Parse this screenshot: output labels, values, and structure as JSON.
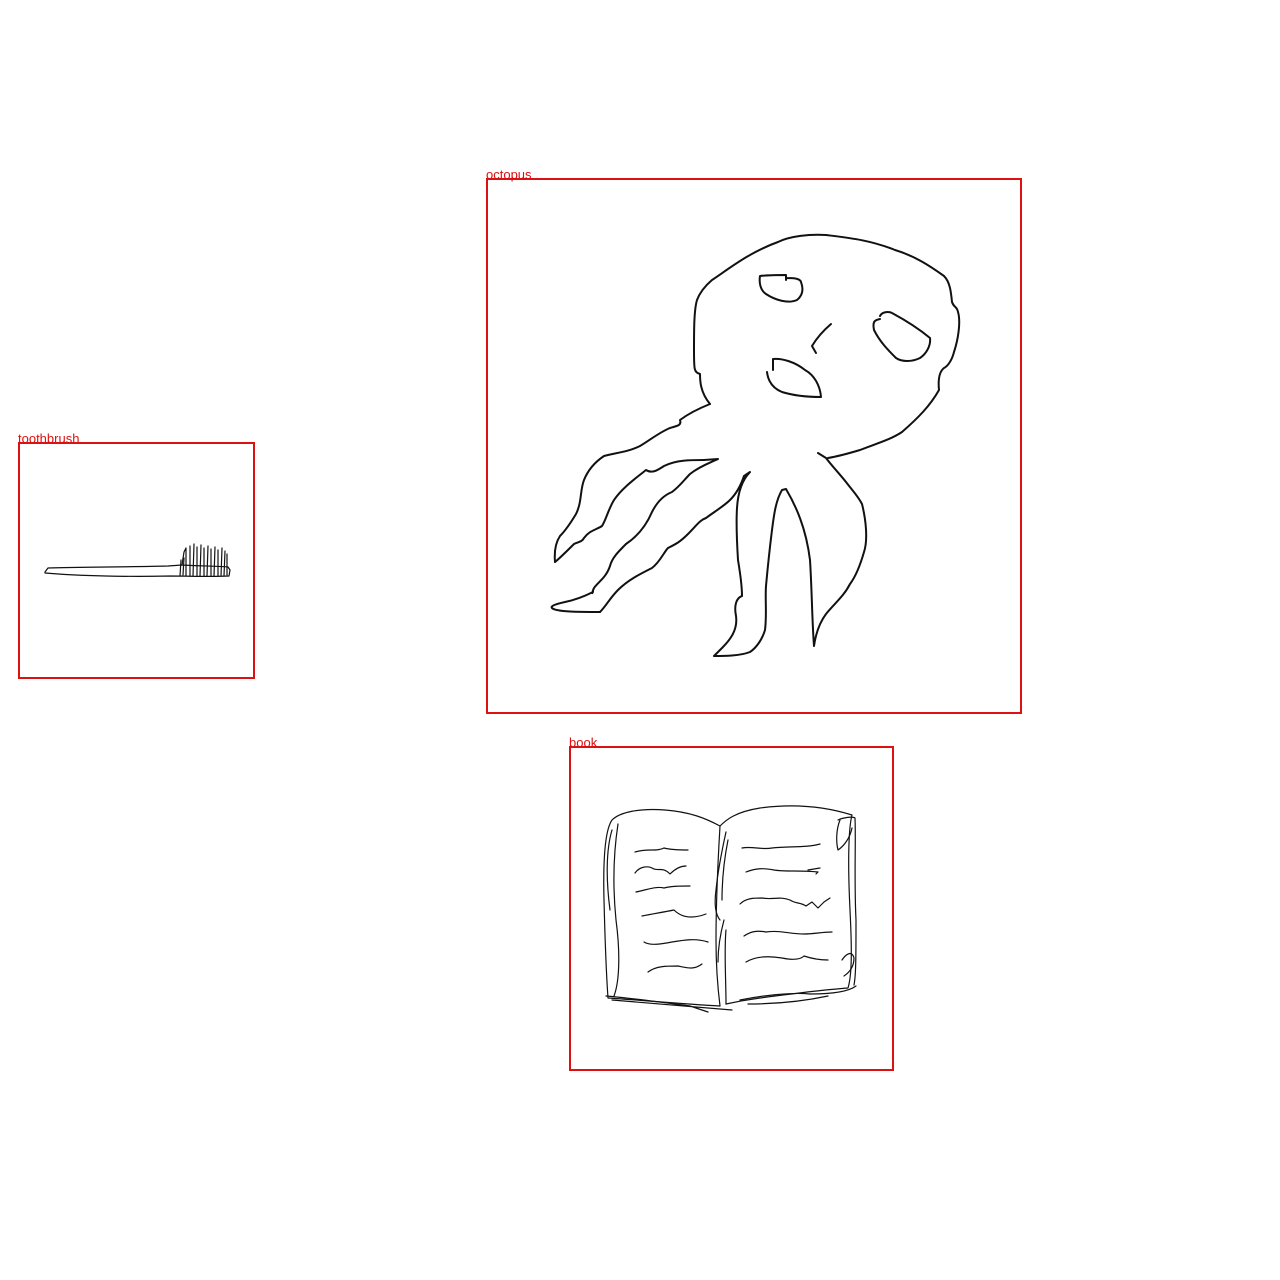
{
  "colors": {
    "box_border": "#dd1111",
    "label_text": "#dd1111",
    "sketch_stroke": "#111111",
    "background": "#ffffff"
  },
  "detections": [
    {
      "id": "octopus",
      "label": "octopus"
    },
    {
      "id": "toothbrush",
      "label": "toothbrush"
    },
    {
      "id": "book",
      "label": "book"
    }
  ]
}
